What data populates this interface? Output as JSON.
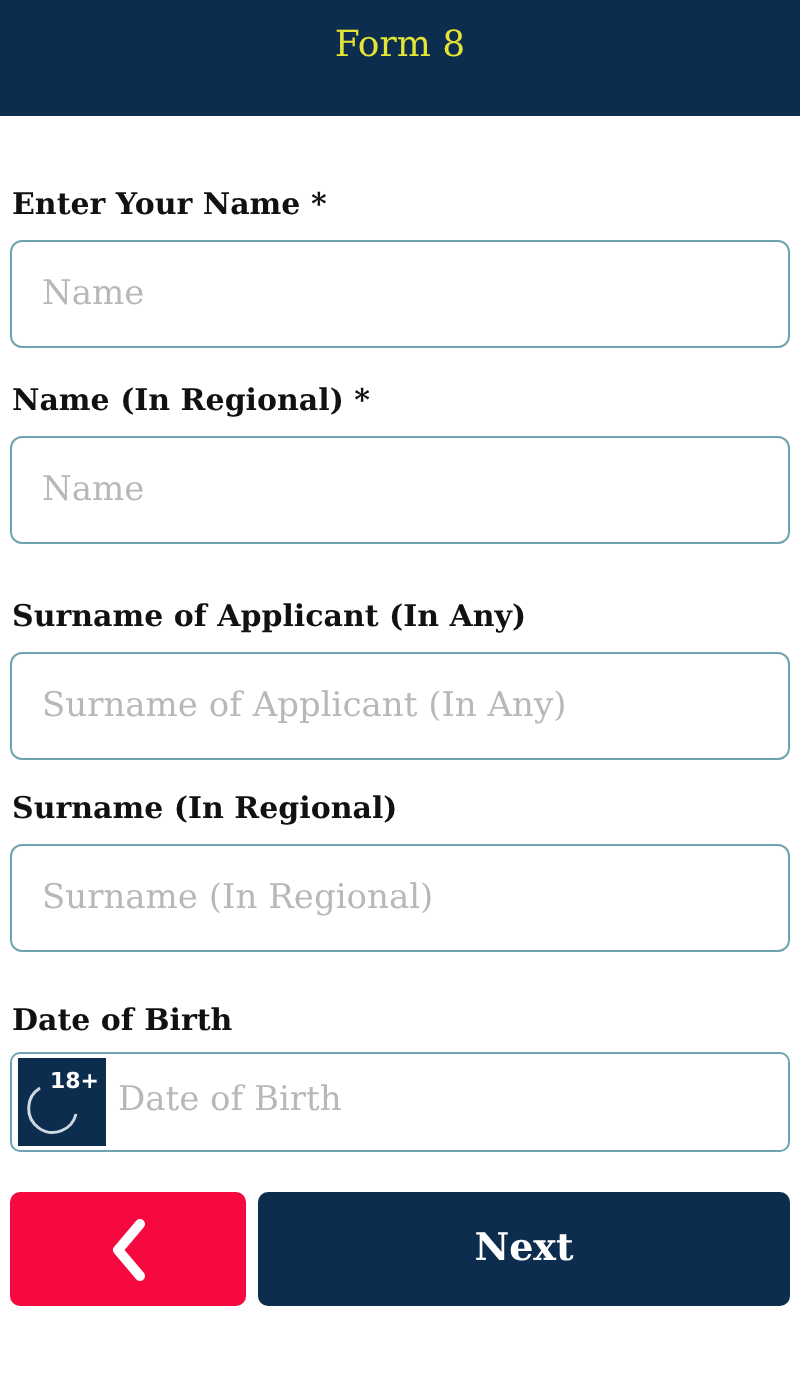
{
  "header": {
    "title": "Form 8"
  },
  "fields": [
    {
      "kind": "text",
      "label": "Enter Your Name *",
      "placeholder": "Name"
    },
    {
      "kind": "text",
      "label": "Name (In Regional) *",
      "placeholder": "Name"
    },
    {
      "kind": "text",
      "label": "Surname of Applicant (In Any)",
      "placeholder": "Surname of Applicant (In Any)"
    },
    {
      "kind": "text",
      "label": "Surname (In Regional)",
      "placeholder": "Surname (In Regional)"
    },
    {
      "kind": "date",
      "label": "Date of Birth",
      "placeholder": "Date of Birth",
      "badge": "18+"
    }
  ],
  "buttons": {
    "next": "Next"
  }
}
